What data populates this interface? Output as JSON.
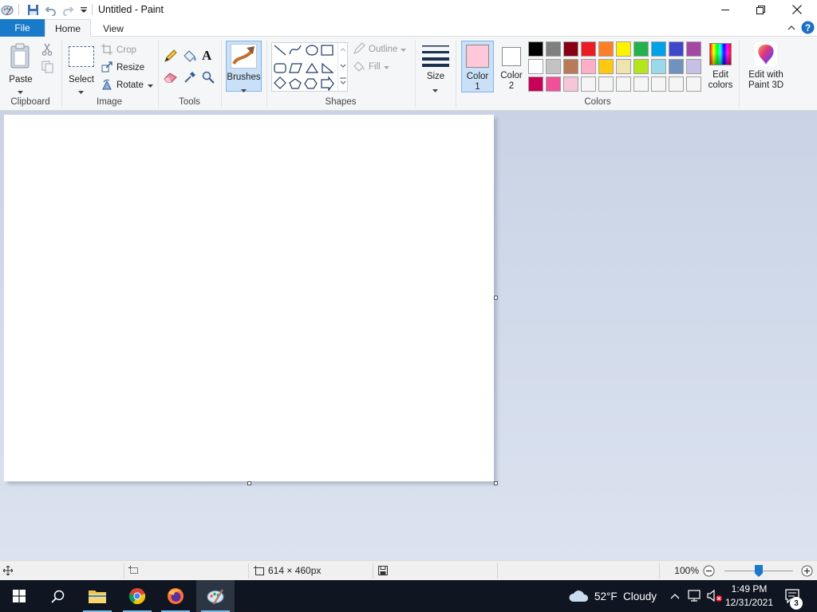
{
  "window": {
    "title": "Untitled - Paint"
  },
  "quick_access": {
    "icons": [
      "paint-app-icon",
      "save-icon",
      "undo-icon",
      "redo-icon",
      "customize-dropdown-icon"
    ]
  },
  "tabs": {
    "file": "File",
    "home": "Home",
    "view": "View"
  },
  "clipboard": {
    "paste": "Paste",
    "group": "Clipboard"
  },
  "image": {
    "select": "Select",
    "crop": "Crop",
    "resize": "Resize",
    "rotate": "Rotate",
    "group": "Image"
  },
  "tools": {
    "group": "Tools"
  },
  "brushes": {
    "label": "Brushes"
  },
  "shapes": {
    "outline": "Outline",
    "fill": "Fill",
    "group": "Shapes"
  },
  "size": {
    "label": "Size"
  },
  "colors": {
    "color1": "Color",
    "color1_num": "1",
    "color2": "Color",
    "color2_num": "2",
    "color1_value": "#ffc8d8",
    "color2_value": "#ffffff",
    "edit_colors_line1": "Edit",
    "edit_colors_line2": "colors",
    "paint3d_line1": "Edit with",
    "paint3d_line2": "Paint 3D",
    "group": "Colors",
    "palette": [
      [
        "#000000",
        "#7f7f7f",
        "#880015",
        "#ed1c24",
        "#ff7f27",
        "#fff200",
        "#22b14c",
        "#00a2e8",
        "#3f48cc",
        "#a349a4"
      ],
      [
        "#ffffff",
        "#c3c3c3",
        "#b97a57",
        "#ffaec9",
        "#ffc90e",
        "#efe4b0",
        "#b5e61d",
        "#99d9ea",
        "#7092be",
        "#c8bfe7"
      ],
      [
        "#c8005a",
        "#f0509a",
        "#f5c6d8",
        "#f5f5f5",
        "#f5f5f5",
        "#f5f5f5",
        "#f5f5f5",
        "#f5f5f5",
        "#f5f5f5",
        "#f5f5f5"
      ]
    ]
  },
  "status": {
    "dimensions": "614 × 460px",
    "zoom": "100%",
    "zoom_value": 100
  },
  "taskbar": {
    "weather_temp": "52°F",
    "weather_text": "Cloudy",
    "time": "1:49 PM",
    "date": "12/31/2021",
    "notification_count": "3"
  }
}
